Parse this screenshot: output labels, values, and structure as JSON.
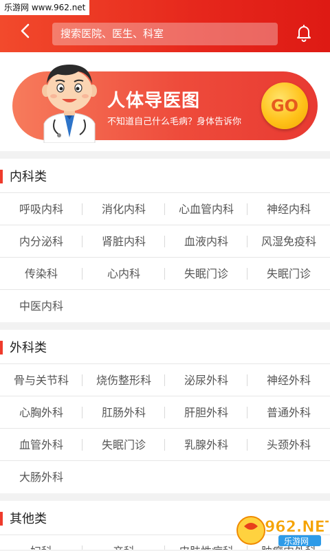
{
  "watermark": "乐游网 www.962.net",
  "header": {
    "search_placeholder": "搜索医院、医生、科室"
  },
  "banner": {
    "title": "人体导医图",
    "subtitle": "不知道自己什么毛病？身体告诉你",
    "go_label": "GO"
  },
  "sections": [
    {
      "title": "内科类",
      "rows": [
        [
          "呼吸内科",
          "消化内科",
          "心血管内科",
          "神经内科"
        ],
        [
          "内分泌科",
          "肾脏内科",
          "血液内科",
          "风湿免疫科"
        ],
        [
          "传染科",
          "心内科",
          "失眠门诊",
          "失眠门诊"
        ],
        [
          "中医内科"
        ]
      ]
    },
    {
      "title": "外科类",
      "rows": [
        [
          "骨与关节科",
          "烧伤整形科",
          "泌尿外科",
          "神经外科"
        ],
        [
          "心胸外科",
          "肛肠外科",
          "肝胆外科",
          "普通外科"
        ],
        [
          "血管外科",
          "失眠门诊",
          "乳腺外科",
          "头颈外科"
        ],
        [
          "大肠外科"
        ]
      ]
    },
    {
      "title": "其他类",
      "rows": [
        [
          "妇科",
          "产科",
          "皮肤性病科",
          "肿瘤内外科"
        ]
      ]
    }
  ],
  "logo": {
    "text": "962.NET",
    "subtext": "乐游网"
  },
  "colors": {
    "header_red": "#e6271c",
    "accent": "#ef3b2c",
    "go_yellow": "#ffc21a"
  }
}
